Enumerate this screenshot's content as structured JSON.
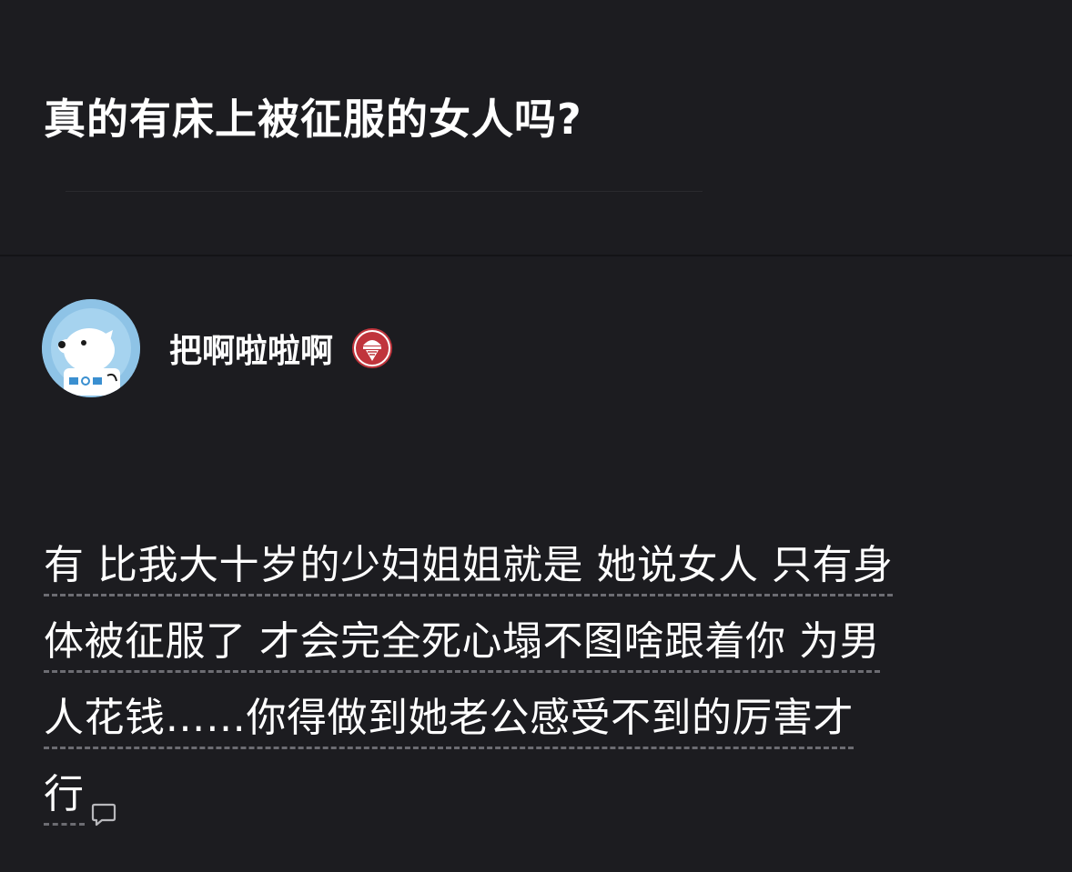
{
  "question": {
    "title": "真的有床上被征服的女人吗?"
  },
  "answer": {
    "author": {
      "name": "把啊啦啦啊",
      "avatar_icon": "dog-astronaut-avatar",
      "badge_icon": "ice-cream-badge-icon"
    },
    "lines": [
      "有 比我大十岁的少妇姐姐就是 她说女人 只有身",
      "体被征服了 才会完全死心塌不图啥跟着你 为男",
      "人花钱……你得做到她老公感受不到的厉害才",
      "行"
    ],
    "comment_icon": "comment-bubble-icon"
  },
  "colors": {
    "background": "#1c1c20",
    "text": "#ffffff",
    "dashed_underline": "#6c6c72",
    "badge_red": "#c0343c",
    "avatar_blue": "#8ec3e6"
  }
}
